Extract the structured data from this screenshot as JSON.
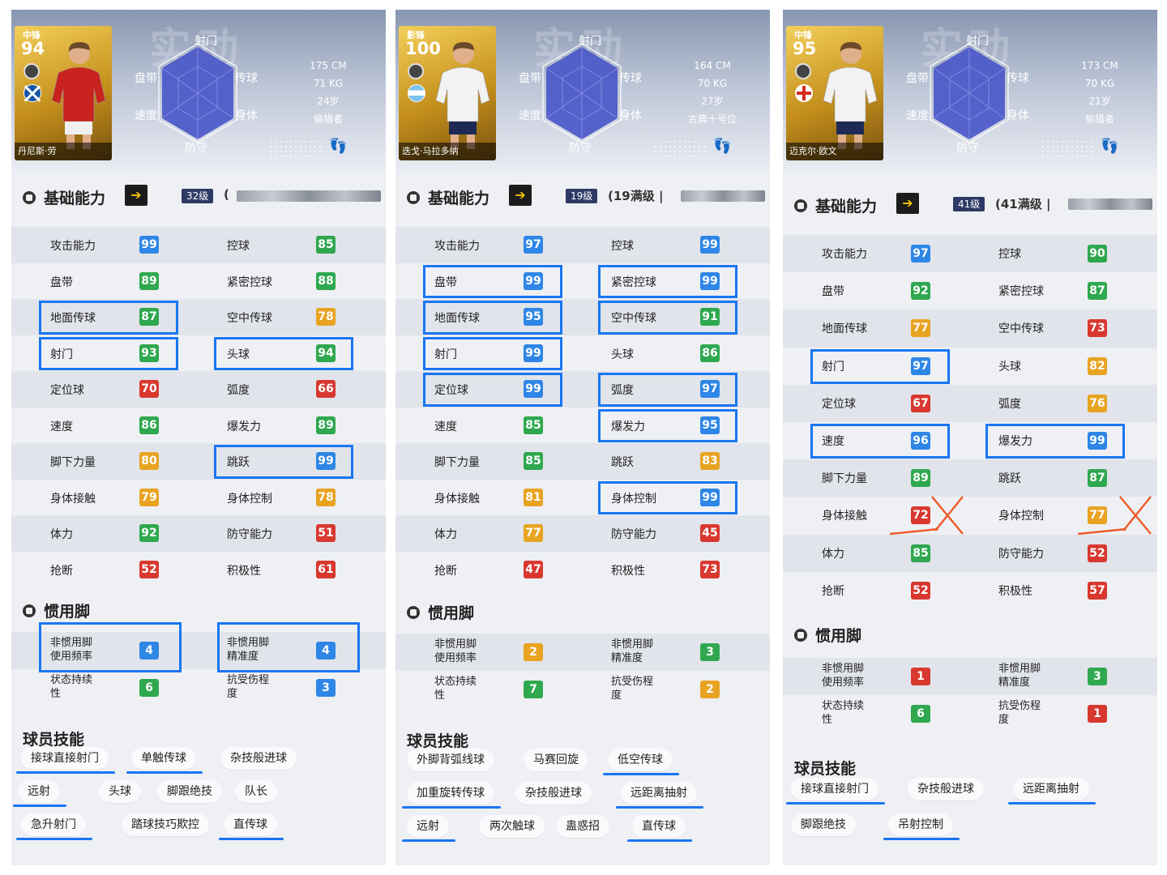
{
  "watermark": "实动",
  "radar_labels": {
    "top": "射门",
    "left": "盘带",
    "right": "传球",
    "bottom_left": "速度",
    "bottom_right": "身体",
    "bottom": "防守"
  },
  "foot_section_title": "惯用脚",
  "skills_section_title": "球员技能",
  "basic_section_title": "基础能力",
  "arrow_glyph": "➔",
  "colors": {
    "blue": "#2e86e6",
    "green": "#2fa84f",
    "yellow": "#e8a321",
    "red": "#d8382f",
    "highlight": "#1976f2",
    "cross": "#f05a2a"
  },
  "panels": [
    {
      "card": {
        "position": "中锋",
        "rating": "94",
        "name": "丹尼斯·劳",
        "flag": "scotland",
        "kit": "red"
      },
      "bio": [
        "175 CM",
        "71 KG",
        "24岁",
        "偷猎者"
      ],
      "level": "32级",
      "level_suffix": "(",
      "attributes": [
        [
          {
            "label": "攻击能力",
            "value": "99",
            "color": "blue"
          },
          {
            "label": "控球",
            "value": "85",
            "color": "green"
          }
        ],
        [
          {
            "label": "盘带",
            "value": "89",
            "color": "green"
          },
          {
            "label": "紧密控球",
            "value": "88",
            "color": "green"
          }
        ],
        [
          {
            "label": "地面传球",
            "value": "87",
            "color": "green"
          },
          {
            "label": "空中传球",
            "value": "78",
            "color": "yellow"
          }
        ],
        [
          {
            "label": "射门",
            "value": "93",
            "color": "green"
          },
          {
            "label": "头球",
            "value": "94",
            "color": "green"
          }
        ],
        [
          {
            "label": "定位球",
            "value": "70",
            "color": "red"
          },
          {
            "label": "弧度",
            "value": "66",
            "color": "red"
          }
        ],
        [
          {
            "label": "速度",
            "value": "86",
            "color": "green"
          },
          {
            "label": "爆发力",
            "value": "89",
            "color": "green"
          }
        ],
        [
          {
            "label": "脚下力量",
            "value": "80",
            "color": "yellow"
          },
          {
            "label": "跳跃",
            "value": "99",
            "color": "blue"
          }
        ],
        [
          {
            "label": "身体接触",
            "value": "79",
            "color": "yellow"
          },
          {
            "label": "身体控制",
            "value": "78",
            "color": "yellow"
          }
        ],
        [
          {
            "label": "体力",
            "value": "92",
            "color": "green"
          },
          {
            "label": "防守能力",
            "value": "51",
            "color": "red"
          }
        ],
        [
          {
            "label": "抢断",
            "value": "52",
            "color": "red"
          },
          {
            "label": "积极性",
            "value": "61",
            "color": "red"
          }
        ]
      ],
      "foot": [
        [
          {
            "label": "非惯用脚\n使用频率",
            "value": "4",
            "color": "blue"
          },
          {
            "label": "非惯用脚\n精准度",
            "value": "4",
            "color": "blue"
          }
        ],
        [
          {
            "label": "状态持续\n性",
            "value": "6",
            "color": "green"
          },
          {
            "label": "抗受伤程\n度",
            "value": "3",
            "color": "blue"
          }
        ]
      ],
      "skills": [
        [
          "接球直接射门",
          "单触传球",
          "杂技般进球"
        ],
        [
          "远射",
          "头球",
          "脚跟绝技",
          "队长"
        ],
        [
          "急升射门",
          "踏球技巧欺控",
          "直传球"
        ]
      ]
    },
    {
      "card": {
        "position": "影锋",
        "rating": "100",
        "name": "迭戈·马拉多纳",
        "flag": "argentina",
        "kit": "white"
      },
      "bio": [
        "164 CM",
        "70 KG",
        "27岁",
        "古典十号位"
      ],
      "level": "19级",
      "level_suffix": "(19满级 |",
      "attributes": [
        [
          {
            "label": "攻击能力",
            "value": "97",
            "color": "blue"
          },
          {
            "label": "控球",
            "value": "99",
            "color": "blue"
          }
        ],
        [
          {
            "label": "盘带",
            "value": "99",
            "color": "blue"
          },
          {
            "label": "紧密控球",
            "value": "99",
            "color": "blue"
          }
        ],
        [
          {
            "label": "地面传球",
            "value": "95",
            "color": "blue"
          },
          {
            "label": "空中传球",
            "value": "91",
            "color": "green"
          }
        ],
        [
          {
            "label": "射门",
            "value": "99",
            "color": "blue"
          },
          {
            "label": "头球",
            "value": "86",
            "color": "green"
          }
        ],
        [
          {
            "label": "定位球",
            "value": "99",
            "color": "blue"
          },
          {
            "label": "弧度",
            "value": "97",
            "color": "blue"
          }
        ],
        [
          {
            "label": "速度",
            "value": "85",
            "color": "green"
          },
          {
            "label": "爆发力",
            "value": "95",
            "color": "blue"
          }
        ],
        [
          {
            "label": "脚下力量",
            "value": "85",
            "color": "green"
          },
          {
            "label": "跳跃",
            "value": "83",
            "color": "yellow"
          }
        ],
        [
          {
            "label": "身体接触",
            "value": "81",
            "color": "yellow"
          },
          {
            "label": "身体控制",
            "value": "99",
            "color": "blue"
          }
        ],
        [
          {
            "label": "体力",
            "value": "77",
            "color": "yellow"
          },
          {
            "label": "防守能力",
            "value": "45",
            "color": "red"
          }
        ],
        [
          {
            "label": "抢断",
            "value": "47",
            "color": "red"
          },
          {
            "label": "积极性",
            "value": "73",
            "color": "red"
          }
        ]
      ],
      "foot": [
        [
          {
            "label": "非惯用脚\n使用频率",
            "value": "2",
            "color": "yellow"
          },
          {
            "label": "非惯用脚\n精准度",
            "value": "3",
            "color": "green"
          }
        ],
        [
          {
            "label": "状态持续\n性",
            "value": "7",
            "color": "green"
          },
          {
            "label": "抗受伤程\n度",
            "value": "2",
            "color": "yellow"
          }
        ]
      ],
      "skills": [
        [
          "外脚背弧线球",
          "马赛回旋",
          "低空传球"
        ],
        [
          "加重旋转传球",
          "杂技般进球",
          "远距离抽射"
        ],
        [
          "远射",
          "两次触球",
          "蛊惑招",
          "直传球"
        ]
      ]
    },
    {
      "card": {
        "position": "中锋",
        "rating": "95",
        "name": "迈克尔·欧文",
        "flag": "england",
        "kit": "white"
      },
      "bio": [
        "173 CM",
        "70 KG",
        "21岁",
        "偷猎者"
      ],
      "level": "41级",
      "level_suffix": "(41满级 |",
      "attributes": [
        [
          {
            "label": "攻击能力",
            "value": "97",
            "color": "blue"
          },
          {
            "label": "控球",
            "value": "90",
            "color": "green"
          }
        ],
        [
          {
            "label": "盘带",
            "value": "92",
            "color": "green"
          },
          {
            "label": "紧密控球",
            "value": "87",
            "color": "green"
          }
        ],
        [
          {
            "label": "地面传球",
            "value": "77",
            "color": "yellow"
          },
          {
            "label": "空中传球",
            "value": "73",
            "color": "red"
          }
        ],
        [
          {
            "label": "射门",
            "value": "97",
            "color": "blue"
          },
          {
            "label": "头球",
            "value": "82",
            "color": "yellow"
          }
        ],
        [
          {
            "label": "定位球",
            "value": "67",
            "color": "red"
          },
          {
            "label": "弧度",
            "value": "76",
            "color": "yellow"
          }
        ],
        [
          {
            "label": "速度",
            "value": "96",
            "color": "blue"
          },
          {
            "label": "爆发力",
            "value": "99",
            "color": "blue"
          }
        ],
        [
          {
            "label": "脚下力量",
            "value": "89",
            "color": "green"
          },
          {
            "label": "跳跃",
            "value": "87",
            "color": "green"
          }
        ],
        [
          {
            "label": "身体接触",
            "value": "72",
            "color": "red"
          },
          {
            "label": "身体控制",
            "value": "77",
            "color": "yellow"
          }
        ],
        [
          {
            "label": "体力",
            "value": "85",
            "color": "green"
          },
          {
            "label": "防守能力",
            "value": "52",
            "color": "red"
          }
        ],
        [
          {
            "label": "抢断",
            "value": "52",
            "color": "red"
          },
          {
            "label": "积极性",
            "value": "57",
            "color": "red"
          }
        ]
      ],
      "foot": [
        [
          {
            "label": "非惯用脚\n使用频率",
            "value": "1",
            "color": "red"
          },
          {
            "label": "非惯用脚\n精准度",
            "value": "3",
            "color": "green"
          }
        ],
        [
          {
            "label": "状态持续\n性",
            "value": "6",
            "color": "green"
          },
          {
            "label": "抗受伤程\n度",
            "value": "1",
            "color": "red"
          }
        ]
      ],
      "skills": [
        [
          "接球直接射门",
          "杂技般进球",
          "远距离抽射"
        ],
        [
          "脚跟绝技",
          "吊射控制"
        ]
      ]
    }
  ]
}
